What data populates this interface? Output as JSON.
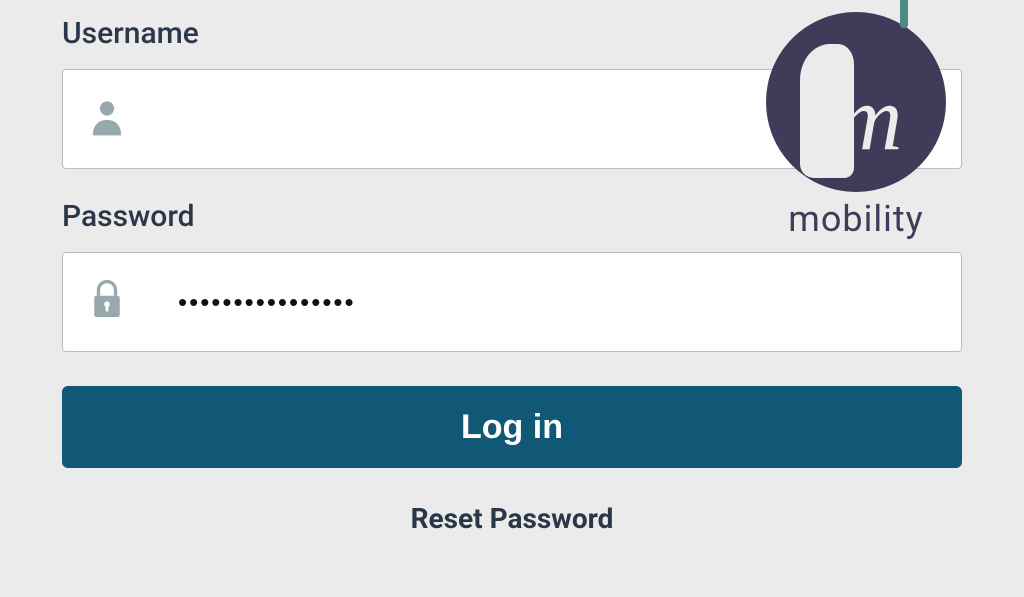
{
  "labels": {
    "username": "Username",
    "password": "Password"
  },
  "inputs": {
    "username_value": "",
    "password_value": "••••••••••••••••"
  },
  "buttons": {
    "login": "Log in",
    "reset": "Reset Password"
  },
  "logo": {
    "letter": "m",
    "text": "mobility"
  }
}
